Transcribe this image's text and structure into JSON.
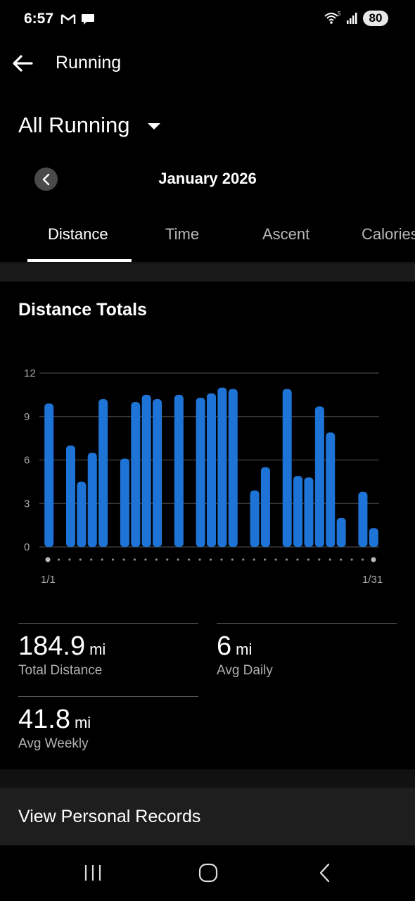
{
  "status": {
    "time": "6:57",
    "battery": "80"
  },
  "app_bar": {
    "title": "Running",
    "back_icon": "arrow-left-icon"
  },
  "activity": {
    "label": "All Running"
  },
  "month": {
    "label": "January 2026"
  },
  "tabs": [
    {
      "label": "Distance",
      "active": true
    },
    {
      "label": "Time",
      "active": false
    },
    {
      "label": "Ascent",
      "active": false
    },
    {
      "label": "Calories",
      "active": false
    }
  ],
  "section_title": "Distance Totals",
  "chart_data": {
    "type": "bar",
    "x_labels": [
      "1/1",
      "1/31"
    ],
    "y_ticks": [
      12,
      9,
      6,
      3,
      0
    ],
    "ylim": [
      0,
      12
    ],
    "bar_color": "#1e74d6",
    "days": [
      1,
      2,
      3,
      4,
      5,
      6,
      7,
      8,
      9,
      10,
      11,
      12,
      13,
      14,
      15,
      16,
      17,
      18,
      19,
      20,
      21,
      22,
      23,
      24,
      25,
      26,
      27,
      28,
      29,
      30,
      31
    ],
    "values": [
      9.9,
      0,
      7.0,
      4.5,
      6.5,
      10.2,
      0,
      6.1,
      10.0,
      10.5,
      10.2,
      0,
      10.5,
      0,
      10.3,
      10.6,
      11.0,
      10.9,
      0,
      3.9,
      5.5,
      0,
      10.9,
      4.9,
      4.8,
      9.7,
      7.9,
      2.0,
      0,
      3.8,
      1.3
    ],
    "grid": true
  },
  "stats": {
    "total_distance": {
      "value": "184.9",
      "unit": "mi",
      "label": "Total Distance"
    },
    "avg_daily": {
      "value": "6",
      "unit": "mi",
      "label": "Avg Daily"
    },
    "avg_weekly": {
      "value": "41.8",
      "unit": "mi",
      "label": "Avg Weekly"
    }
  },
  "personal_records": {
    "label": "View Personal Records"
  },
  "colors": {
    "background": "#000000",
    "accent": "#1e74d6",
    "card": "#1e1e1e"
  }
}
